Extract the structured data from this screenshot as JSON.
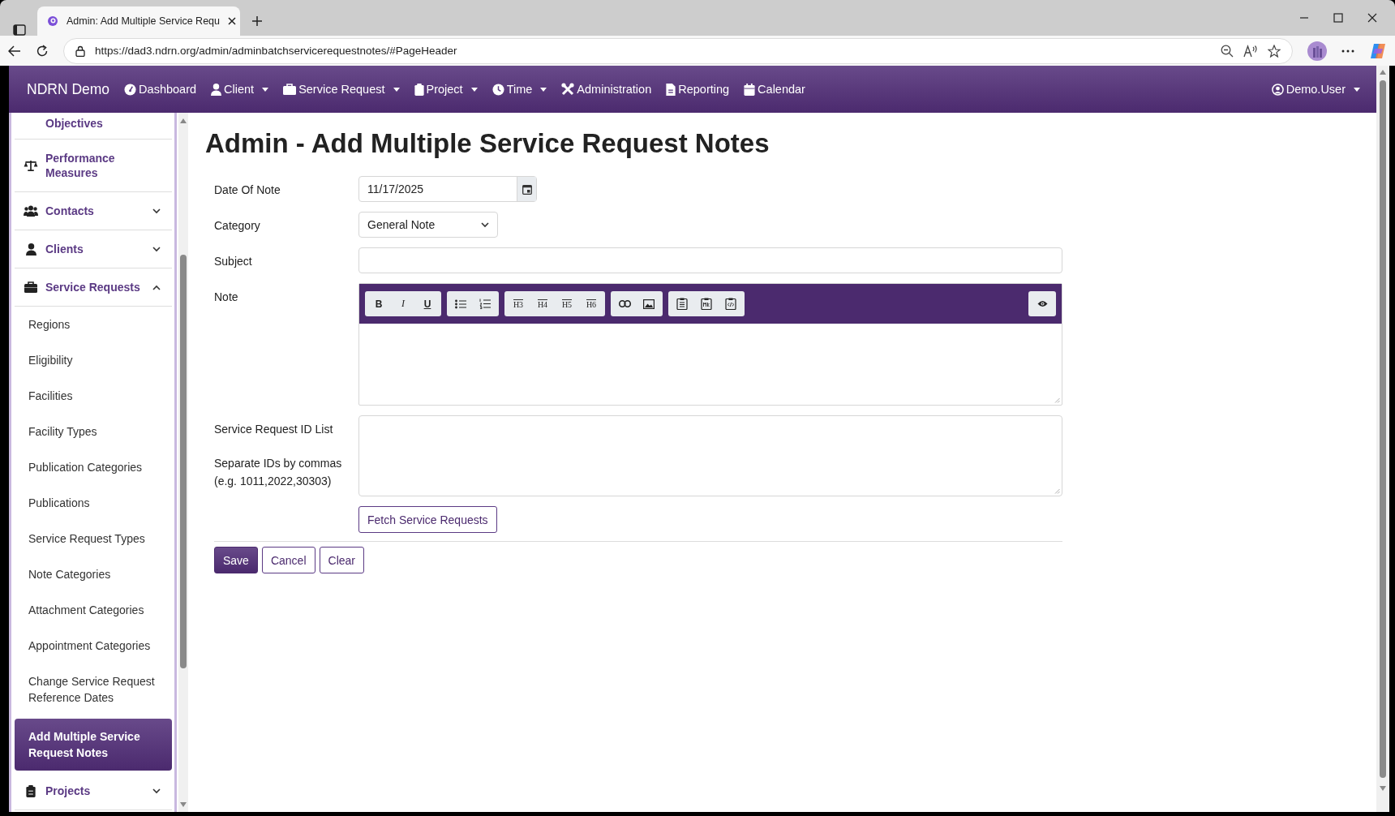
{
  "browser": {
    "tab_title": "Admin: Add Multiple Service Requ",
    "url": "https://dad3.ndrn.org/admin/adminbatchservicerequestnotes/#PageHeader"
  },
  "navbar": {
    "brand": "NDRN Demo",
    "items": [
      {
        "label": "Dashboard",
        "dropdown": false
      },
      {
        "label": "Client",
        "dropdown": true
      },
      {
        "label": "Service Request",
        "dropdown": true
      },
      {
        "label": "Project",
        "dropdown": true
      },
      {
        "label": "Time",
        "dropdown": true
      },
      {
        "label": "Administration",
        "dropdown": false
      },
      {
        "label": "Reporting",
        "dropdown": false
      },
      {
        "label": "Calendar",
        "dropdown": false
      }
    ],
    "user": {
      "label": "Demo.User",
      "dropdown": true
    }
  },
  "sidebar": {
    "items": [
      {
        "kind": "link",
        "label": "Objectives"
      },
      {
        "kind": "link",
        "label": "Performance Measures"
      },
      {
        "kind": "group",
        "label": "Contacts",
        "expanded": false
      },
      {
        "kind": "group",
        "label": "Clients",
        "expanded": false
      },
      {
        "kind": "group",
        "label": "Service Requests",
        "expanded": true,
        "children": [
          {
            "label": "Regions",
            "selected": false
          },
          {
            "label": "Eligibility",
            "selected": false
          },
          {
            "label": "Facilities",
            "selected": false
          },
          {
            "label": "Facility Types",
            "selected": false
          },
          {
            "label": "Publication Categories",
            "selected": false
          },
          {
            "label": "Publications",
            "selected": false
          },
          {
            "label": "Service Request Types",
            "selected": false
          },
          {
            "label": "Note Categories",
            "selected": false
          },
          {
            "label": "Attachment Categories",
            "selected": false
          },
          {
            "label": "Appointment Categories",
            "selected": false
          },
          {
            "label": "Change Service Request Reference Dates",
            "selected": false
          },
          {
            "label": "Add Multiple Service Request Notes",
            "selected": true
          }
        ]
      },
      {
        "kind": "group",
        "label": "Projects",
        "expanded": false
      }
    ]
  },
  "page": {
    "title": "Admin - Add Multiple Service Request Notes"
  },
  "form": {
    "date_of_note": {
      "label": "Date Of Note",
      "value": "11/17/2025"
    },
    "category": {
      "label": "Category",
      "value": "General Note"
    },
    "subject": {
      "label": "Subject"
    },
    "note": {
      "label": "Note",
      "toolbar": [
        [
          {
            "kind": "bold",
            "label": "B"
          },
          {
            "kind": "italic",
            "label": "I"
          },
          {
            "kind": "underline",
            "label": "U"
          }
        ],
        [
          {
            "kind": "bullet-list"
          },
          {
            "kind": "numbered-list"
          }
        ],
        [
          {
            "kind": "heading",
            "label": "H3"
          },
          {
            "kind": "heading",
            "label": "H4"
          },
          {
            "kind": "heading",
            "label": "H5"
          },
          {
            "kind": "heading",
            "label": "H6"
          }
        ],
        [
          {
            "kind": "link"
          },
          {
            "kind": "image"
          }
        ],
        [
          {
            "kind": "clipboard"
          },
          {
            "kind": "markdown"
          },
          {
            "kind": "code"
          }
        ]
      ],
      "preview": {
        "kind": "preview"
      }
    },
    "id_list": {
      "label": "Service Request ID List",
      "hint_lines": [
        "Separate IDs by commas",
        "(e.g. 1011,2022,30303)"
      ]
    },
    "fetch_button": "Fetch Service Requests",
    "actions": [
      {
        "label": "Save",
        "kind": "primary"
      },
      {
        "label": "Cancel",
        "kind": "outline"
      },
      {
        "label": "Clear",
        "kind": "outline"
      }
    ]
  }
}
